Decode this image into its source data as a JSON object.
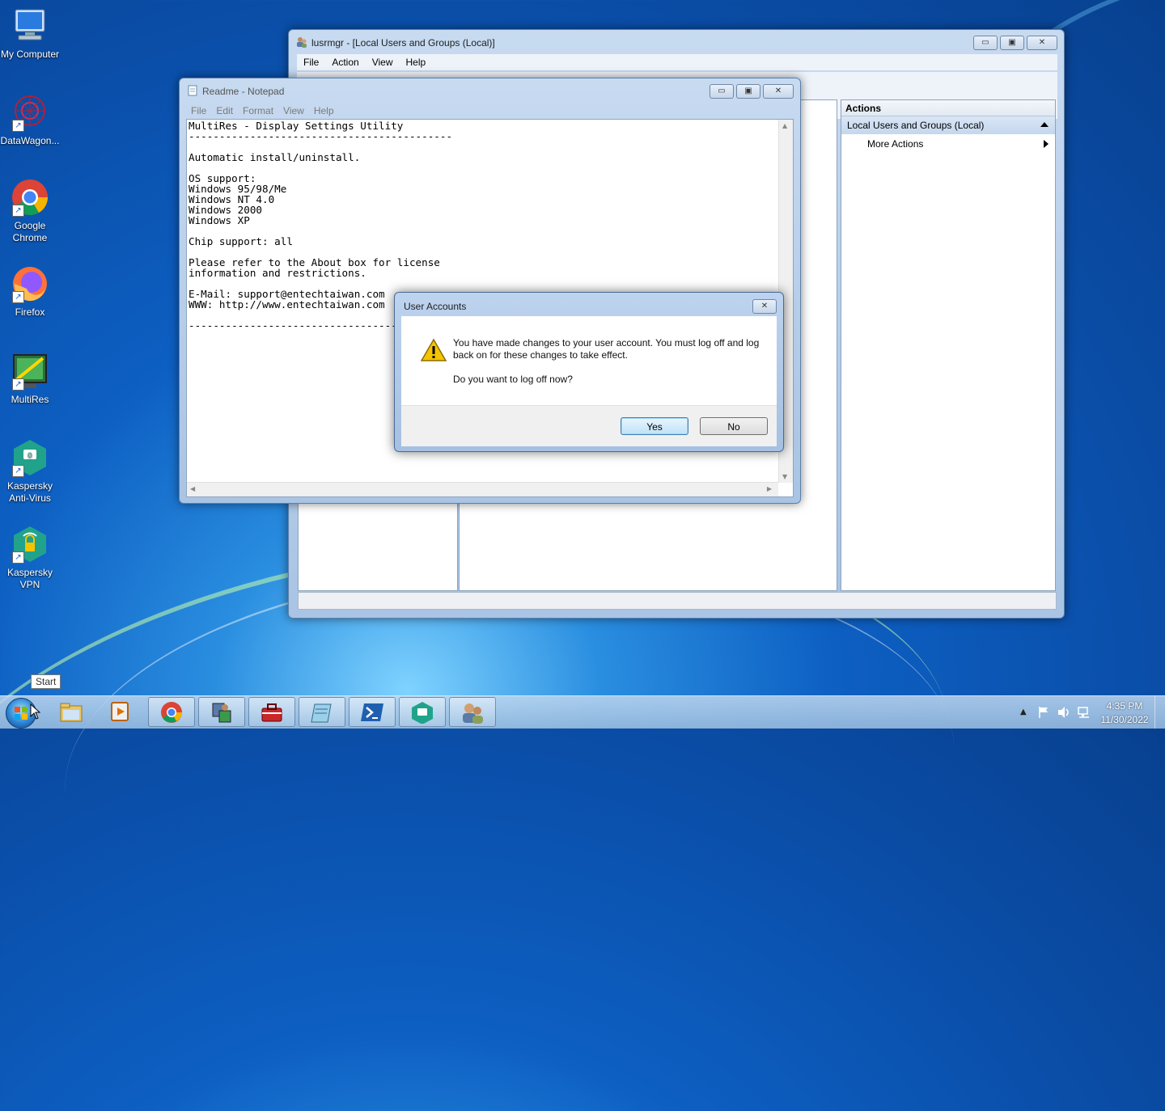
{
  "desktop": {
    "icons": [
      {
        "label": "My Computer"
      },
      {
        "label": "DataWagon..."
      },
      {
        "label": "Google Chrome"
      },
      {
        "label": "Firefox"
      },
      {
        "label": "MultiRes"
      },
      {
        "label": "Kaspersky Anti-Virus"
      },
      {
        "label": "Kaspersky VPN"
      }
    ]
  },
  "mmc": {
    "title": "lusrmgr - [Local Users and Groups (Local)]",
    "menu": [
      "File",
      "Action",
      "View",
      "Help"
    ],
    "actions_header": "Actions",
    "actions_group": "Local Users and Groups (Local)",
    "actions_item": "More Actions"
  },
  "notepad": {
    "title": "Readme - Notepad",
    "menu": [
      "File",
      "Edit",
      "Format",
      "View",
      "Help"
    ],
    "content": "MultiRes - Display Settings Utility\n-------------------------------------------\n\nAutomatic install/uninstall.\n\nOS support:\nWindows 95/98/Me\nWindows NT 4.0\nWindows 2000\nWindows XP\n\nChip support: all\n\nPlease refer to the About box for license\ninformation and restrictions.\n\nE-Mail: support@entechtaiwan.com\nWWW: http://www.entechtaiwan.com\n\n-------------------------------------------"
  },
  "dialog": {
    "title": "User Accounts",
    "message": "You have made changes to your user account. You must log off and log back on for these changes to take effect.",
    "question": "Do you want to log off now?",
    "yes_label": "Yes",
    "no_label": "No"
  },
  "taskbar": {
    "start_tooltip": "Start",
    "time": "4:35 PM",
    "date": "11/30/2022"
  },
  "colors": {
    "desktop_blue": "#0d5fc2",
    "window_frame": "#a9c4e4",
    "default_button": "#3c7fb1"
  }
}
